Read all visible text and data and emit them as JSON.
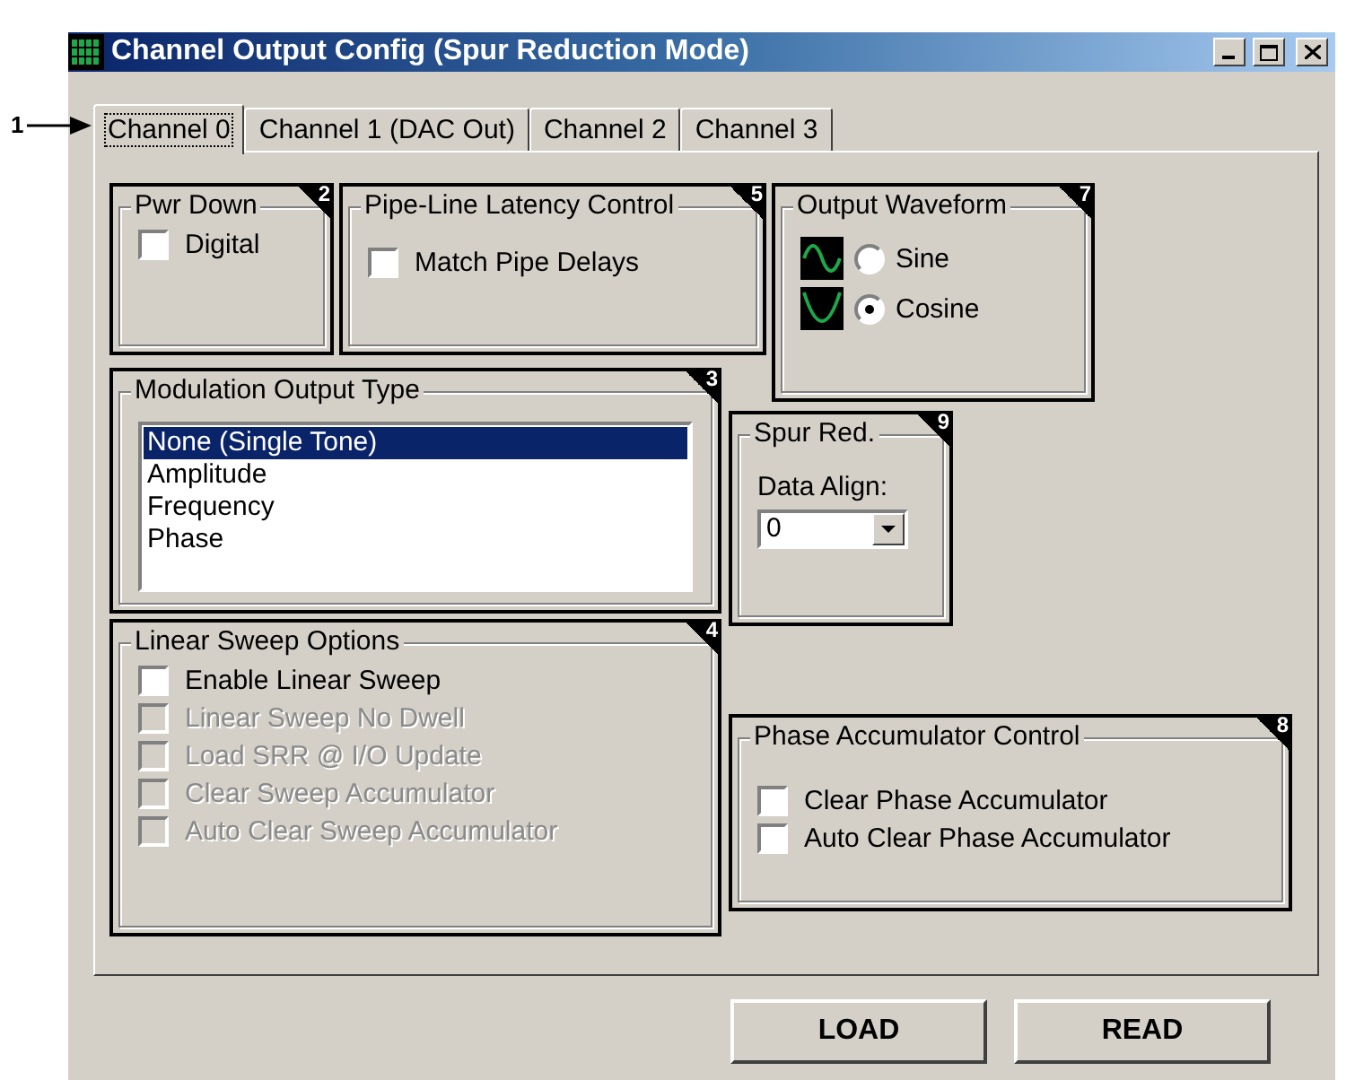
{
  "window": {
    "title": "Channel Output Config (Spur Reduction Mode)"
  },
  "annotation": {
    "label": "1"
  },
  "tabs": [
    {
      "label": "Channel 0",
      "selected": true
    },
    {
      "label": "Channel 1 (DAC Out)",
      "selected": false
    },
    {
      "label": "Channel 2",
      "selected": false
    },
    {
      "label": "Channel 3",
      "selected": false
    }
  ],
  "power_down": {
    "title": "Pwr Down",
    "badge": "2",
    "options": [
      {
        "label": "Digital",
        "checked": false,
        "disabled": false
      }
    ]
  },
  "pipeline": {
    "title": "Pipe-Line Latency Control",
    "badge": "5",
    "options": [
      {
        "label": "Match Pipe Delays",
        "checked": false,
        "disabled": false
      }
    ]
  },
  "output_waveform": {
    "title": "Output Waveform",
    "badge": "7",
    "options": [
      {
        "label": "Sine",
        "kind": "sine",
        "selected": false
      },
      {
        "label": "Cosine",
        "kind": "cosine",
        "selected": true
      }
    ]
  },
  "modulation": {
    "title": "Modulation Output Type",
    "badge": "3",
    "items": [
      {
        "label": "None (Single Tone)",
        "selected": true
      },
      {
        "label": "Amplitude",
        "selected": false
      },
      {
        "label": "Frequency",
        "selected": false
      },
      {
        "label": "Phase",
        "selected": false
      }
    ]
  },
  "spur_reduction": {
    "title": "Spur Red.",
    "badge": "9",
    "field_label": "Data Align:",
    "value": "0"
  },
  "linear_sweep": {
    "title": "Linear Sweep Options",
    "badge": "4",
    "options": [
      {
        "label": "Enable Linear Sweep",
        "checked": false,
        "disabled": false
      },
      {
        "label": "Linear Sweep No Dwell",
        "checked": false,
        "disabled": true
      },
      {
        "label": "Load SRR @ I/O Update",
        "checked": false,
        "disabled": true
      },
      {
        "label": "Clear Sweep Accumulator",
        "checked": false,
        "disabled": true
      },
      {
        "label": "Auto Clear Sweep Accumulator",
        "checked": false,
        "disabled": true
      }
    ]
  },
  "phase_accumulator": {
    "title": "Phase Accumulator Control",
    "badge": "8",
    "options": [
      {
        "label": "Clear Phase Accumulator",
        "checked": false,
        "disabled": false
      },
      {
        "label": "Auto Clear Phase Accumulator",
        "checked": false,
        "disabled": false
      }
    ]
  },
  "buttons": [
    "LOAD",
    "READ"
  ]
}
